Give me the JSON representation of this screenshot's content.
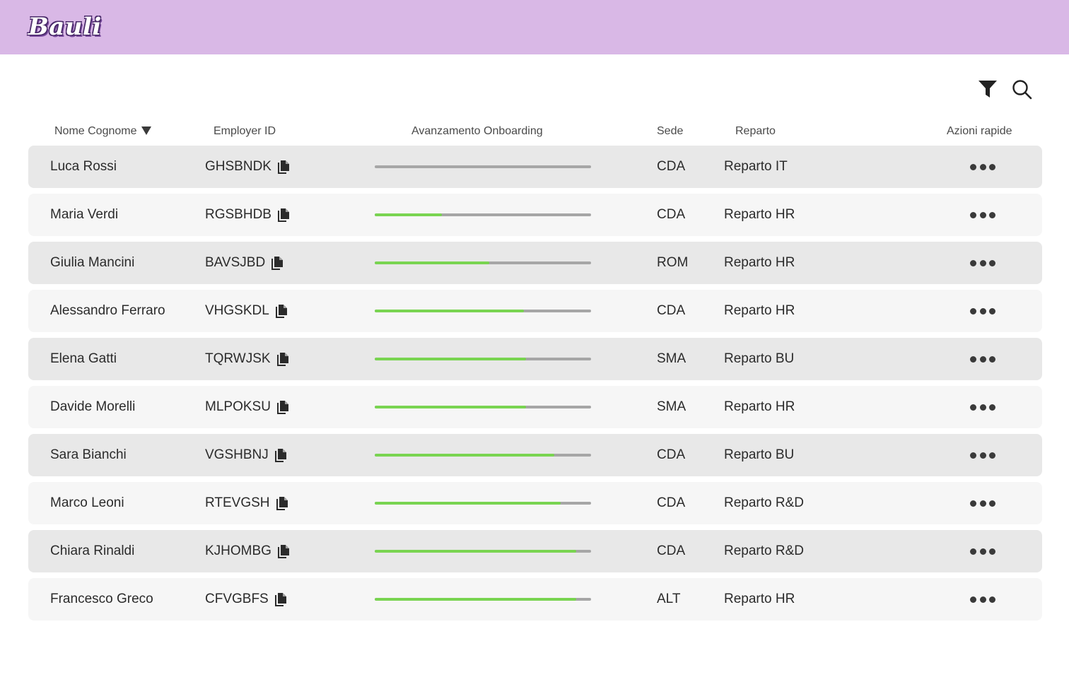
{
  "app": {
    "logo_text": "Bauli"
  },
  "toolbar": {
    "filter_icon": "filter-icon",
    "search_icon": "search-icon"
  },
  "table": {
    "columns": {
      "name": "Nome Cognome",
      "employer_id": "Employer ID",
      "progress": "Avanzamento Onboarding",
      "sede": "Sede",
      "reparto": "Reparto",
      "actions": "Azioni rapide"
    },
    "rows": [
      {
        "name": "Luca Rossi",
        "employer_id": "GHSBNDK",
        "progress": 0,
        "sede": "CDA",
        "reparto": "Reparto IT"
      },
      {
        "name": "Maria Verdi",
        "employer_id": "RGSBHDB",
        "progress": 0.31,
        "sede": "CDA",
        "reparto": "Reparto HR"
      },
      {
        "name": "Giulia Mancini",
        "employer_id": "BAVSJBD",
        "progress": 0.53,
        "sede": "ROM",
        "reparto": "Reparto HR"
      },
      {
        "name": "Alessandro Ferraro",
        "employer_id": "VHGSKDL",
        "progress": 0.69,
        "sede": "CDA",
        "reparto": "Reparto HR"
      },
      {
        "name": "Elena Gatti",
        "employer_id": "TQRWJSK",
        "progress": 0.7,
        "sede": "SMA",
        "reparto": "Reparto BU"
      },
      {
        "name": "Davide Morelli",
        "employer_id": "MLPOKSU",
        "progress": 0.7,
        "sede": "SMA",
        "reparto": "Reparto HR"
      },
      {
        "name": "Sara Bianchi",
        "employer_id": "VGSHBNJ",
        "progress": 0.83,
        "sede": "CDA",
        "reparto": "Reparto BU"
      },
      {
        "name": "Marco Leoni",
        "employer_id": "RTEVGSH",
        "progress": 0.86,
        "sede": "CDA",
        "reparto": "Reparto R&D"
      },
      {
        "name": "Chiara Rinaldi",
        "employer_id": "KJHOMBG",
        "progress": 0.93,
        "sede": "CDA",
        "reparto": "Reparto R&D"
      },
      {
        "name": "Francesco Greco",
        "employer_id": "CFVGBFS",
        "progress": 0.93,
        "sede": "ALT",
        "reparto": "Reparto HR"
      }
    ]
  },
  "colors": {
    "header_bg": "#d9b8e6",
    "progress_fill": "#79d451",
    "progress_track": "#a6a6a6"
  }
}
